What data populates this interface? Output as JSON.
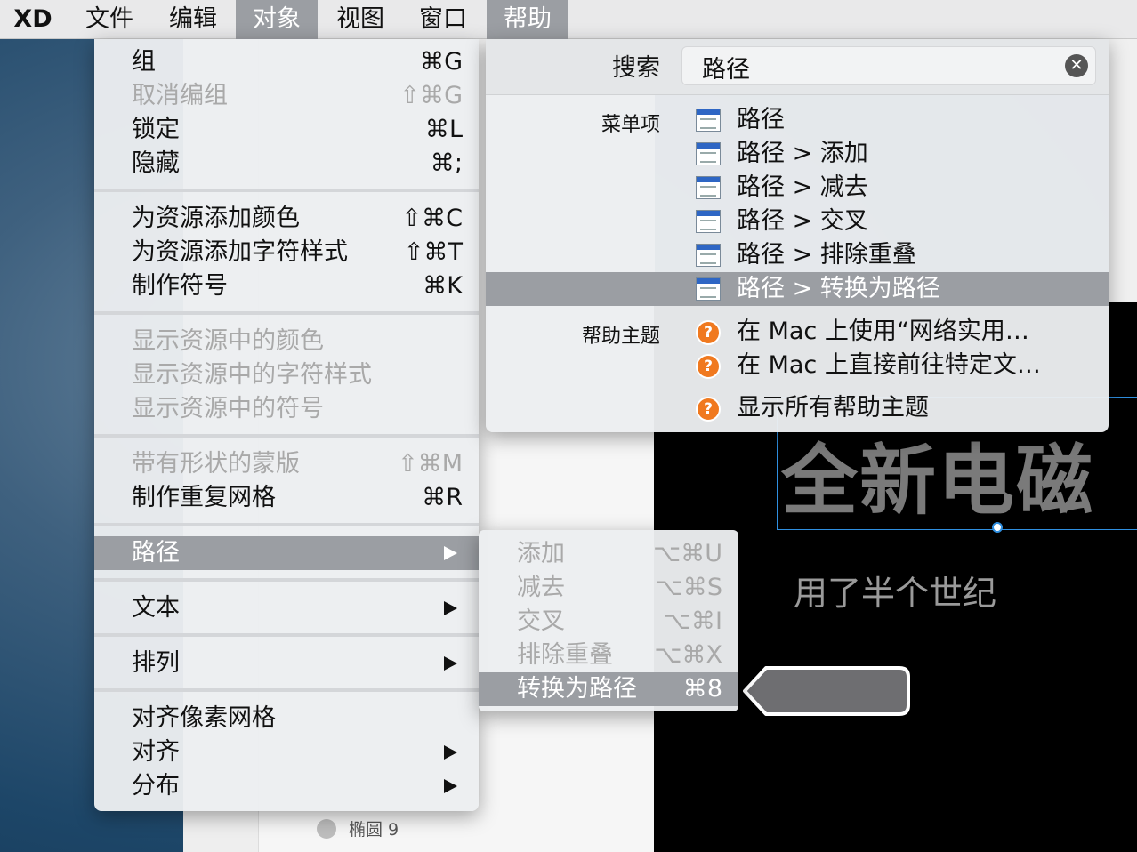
{
  "menubar": {
    "app": "XD",
    "items": [
      "文件",
      "编辑",
      "对象",
      "视图",
      "窗口",
      "帮助"
    ]
  },
  "object_menu": {
    "items": [
      {
        "label": "组",
        "shortcut": "⌘G"
      },
      {
        "label": "取消编组",
        "shortcut": "⇧⌘G"
      },
      {
        "label": "锁定",
        "shortcut": "⌘L"
      },
      {
        "label": "隐藏",
        "shortcut": "⌘;"
      },
      {
        "label": "为资源添加颜色",
        "shortcut": "⇧⌘C"
      },
      {
        "label": "为资源添加字符样式",
        "shortcut": "⇧⌘T"
      },
      {
        "label": "制作符号",
        "shortcut": "⌘K"
      },
      {
        "label": "显示资源中的颜色"
      },
      {
        "label": "显示资源中的字符样式"
      },
      {
        "label": "显示资源中的符号"
      },
      {
        "label": "带有形状的蒙版",
        "shortcut": "⇧⌘M"
      },
      {
        "label": "制作重复网格",
        "shortcut": "⌘R"
      },
      {
        "label": "路径"
      },
      {
        "label": "文本"
      },
      {
        "label": "排列"
      },
      {
        "label": "对齐像素网格"
      },
      {
        "label": "对齐"
      },
      {
        "label": "分布"
      }
    ]
  },
  "path_submenu": {
    "items": [
      {
        "label": "添加",
        "shortcut": "⌥⌘U"
      },
      {
        "label": "减去",
        "shortcut": "⌥⌘S"
      },
      {
        "label": "交叉",
        "shortcut": "⌥⌘I"
      },
      {
        "label": "排除重叠",
        "shortcut": "⌥⌘X"
      },
      {
        "label": "转换为路径",
        "shortcut": "⌘8"
      }
    ]
  },
  "help_menu": {
    "search_label": "搜索",
    "search_value": "路径",
    "menu_items_label": "菜单项",
    "menu_results": [
      "路径",
      "路径 > 添加",
      "路径 > 减去",
      "路径 > 交叉",
      "路径 > 排除重叠",
      "路径 > 转换为路径"
    ],
    "help_topics_label": "帮助主题",
    "help_results": [
      "在 Mac 上使用“网络实用…",
      "在 Mac 上直接前往特定文…",
      "显示所有帮助主题"
    ]
  },
  "canvas": {
    "headline": "全新电磁",
    "subtitle": "用了半个世纪"
  },
  "layers": {
    "ellipse_label": "椭圆 9"
  },
  "colors": {
    "highlight": "#9b9ea3",
    "help_icon": "#f0791f",
    "selection": "#2f8fe0"
  }
}
